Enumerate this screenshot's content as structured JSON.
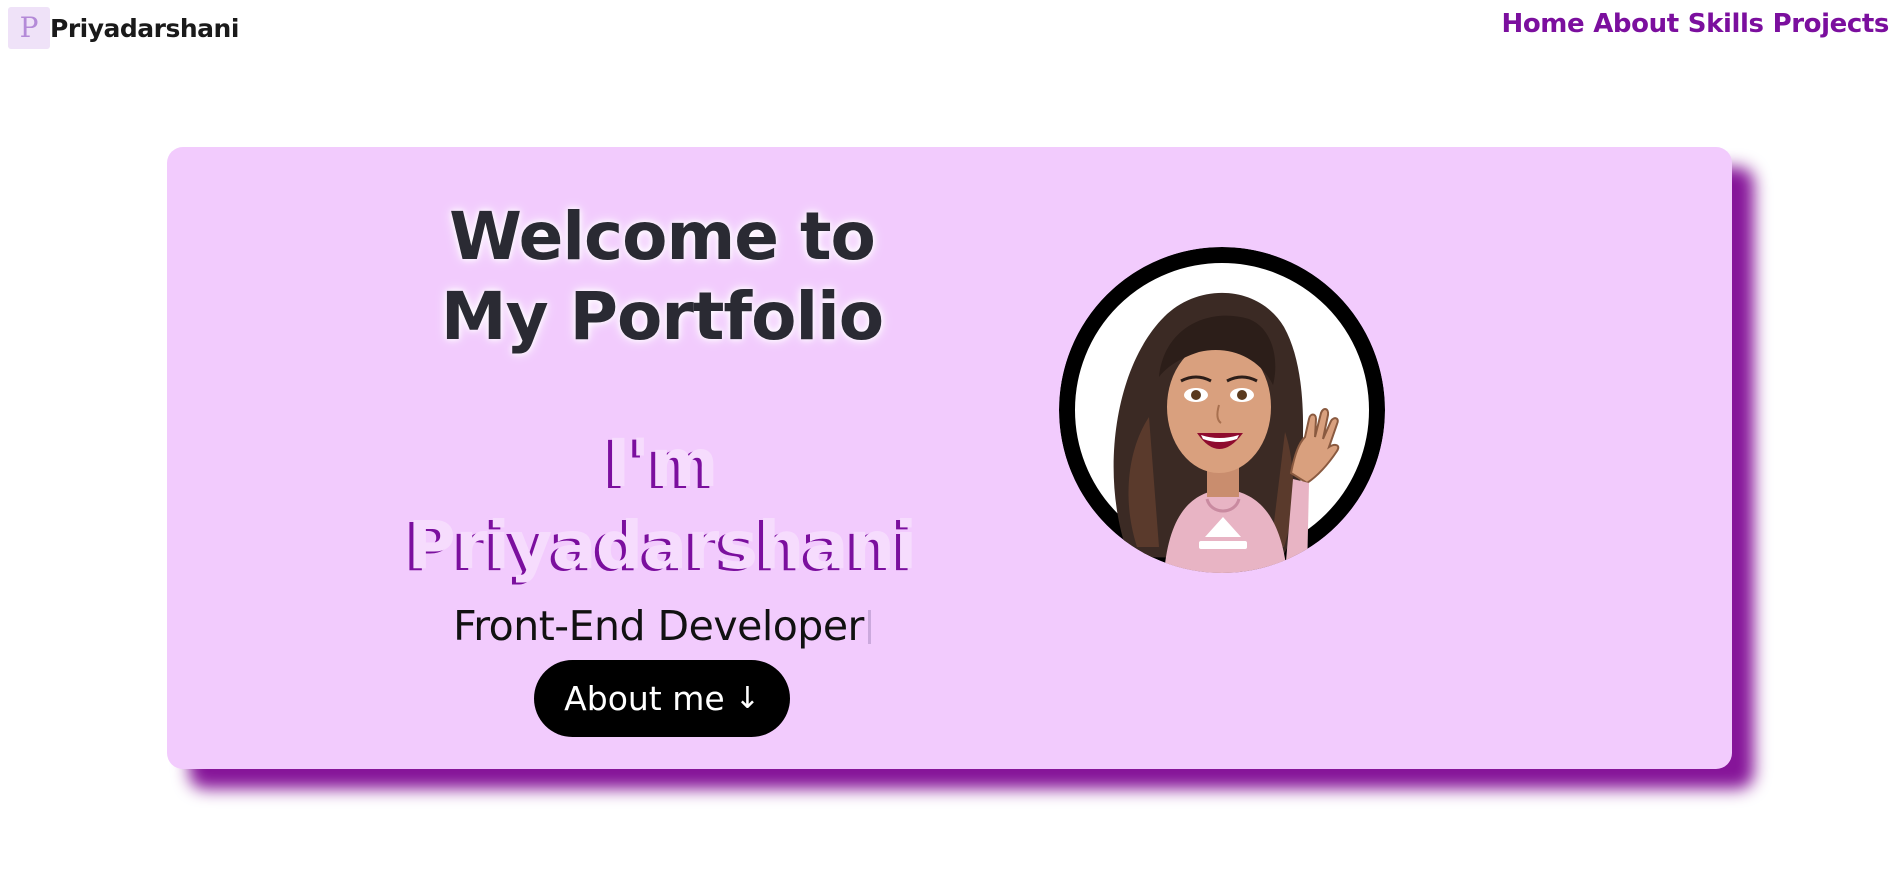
{
  "navbar": {
    "logo_letter": "P",
    "brand_name": "Priyadarshani",
    "links": [
      "Home",
      "About",
      "Skills",
      "Projects"
    ]
  },
  "hero": {
    "title": "Welcome to My Portfolio",
    "greeting_line1": "I'm",
    "greeting_line2": "Priyadarshani",
    "role": "Front-End Developer",
    "button_label": "About me",
    "button_icon": "arrow-down-icon",
    "avatar_icon": "avatar-illustration"
  },
  "colors": {
    "accent": "#7b0f9e",
    "card_background": "#f2cbfd",
    "button_background": "#000000"
  }
}
